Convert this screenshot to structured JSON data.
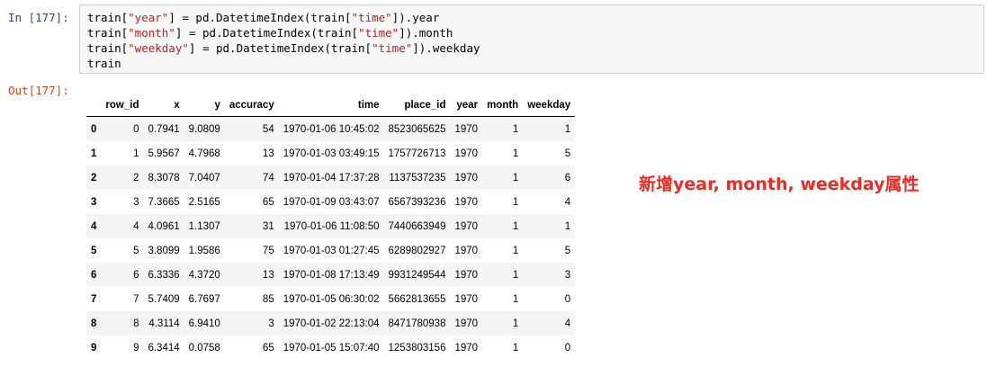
{
  "cell": {
    "in_prompt": "In [177]:",
    "out_prompt": "Out[177]:",
    "code": [
      [
        {
          "t": "train[",
          "s": false
        },
        {
          "t": "\"year\"",
          "s": true
        },
        {
          "t": "] = pd.DatetimeIndex(train[",
          "s": false
        },
        {
          "t": "\"time\"",
          "s": true
        },
        {
          "t": "]).year",
          "s": false
        }
      ],
      [
        {
          "t": "train[",
          "s": false
        },
        {
          "t": "\"month\"",
          "s": true
        },
        {
          "t": "] = pd.DatetimeIndex(train[",
          "s": false
        },
        {
          "t": "\"time\"",
          "s": true
        },
        {
          "t": "]).month",
          "s": false
        }
      ],
      [
        {
          "t": "train[",
          "s": false
        },
        {
          "t": "\"weekday\"",
          "s": true
        },
        {
          "t": "] = pd.DatetimeIndex(train[",
          "s": false
        },
        {
          "t": "\"time\"",
          "s": true
        },
        {
          "t": "]).weekday",
          "s": false
        }
      ],
      [
        {
          "t": "train",
          "s": false
        }
      ]
    ]
  },
  "table": {
    "columns": [
      "",
      "row_id",
      "x",
      "y",
      "accuracy",
      "time",
      "place_id",
      "year",
      "month",
      "weekday"
    ],
    "rows": [
      [
        "0",
        "0",
        "0.7941",
        "9.0809",
        "54",
        "1970-01-06 10:45:02",
        "8523065625",
        "1970",
        "1",
        "1"
      ],
      [
        "1",
        "1",
        "5.9567",
        "4.7968",
        "13",
        "1970-01-03 03:49:15",
        "1757726713",
        "1970",
        "1",
        "5"
      ],
      [
        "2",
        "2",
        "8.3078",
        "7.0407",
        "74",
        "1970-01-04 17:37:28",
        "1137537235",
        "1970",
        "1",
        "6"
      ],
      [
        "3",
        "3",
        "7.3665",
        "2.5165",
        "65",
        "1970-01-09 03:43:07",
        "6567393236",
        "1970",
        "1",
        "4"
      ],
      [
        "4",
        "4",
        "4.0961",
        "1.1307",
        "31",
        "1970-01-06 11:08:50",
        "7440663949",
        "1970",
        "1",
        "1"
      ],
      [
        "5",
        "5",
        "3.8099",
        "1.9586",
        "75",
        "1970-01-03 01:27:45",
        "6289802927",
        "1970",
        "1",
        "5"
      ],
      [
        "6",
        "6",
        "6.3336",
        "4.3720",
        "13",
        "1970-01-08 17:13:49",
        "9931249544",
        "1970",
        "1",
        "3"
      ],
      [
        "7",
        "7",
        "5.7409",
        "6.7697",
        "85",
        "1970-01-05 06:30:02",
        "5662813655",
        "1970",
        "1",
        "0"
      ],
      [
        "8",
        "8",
        "4.3114",
        "6.9410",
        "3",
        "1970-01-02 22:13:04",
        "8471780938",
        "1970",
        "1",
        "4"
      ],
      [
        "9",
        "9",
        "6.3414",
        "0.0758",
        "65",
        "1970-01-05 15:07:40",
        "1253803156",
        "1970",
        "1",
        "0"
      ]
    ]
  },
  "annotation": "新增year, month, weekday属性",
  "colors": {
    "in_prompt": "#303F9F",
    "out_prompt": "#D84315",
    "string": "#BA2121",
    "annotation": "#ee2b23"
  }
}
